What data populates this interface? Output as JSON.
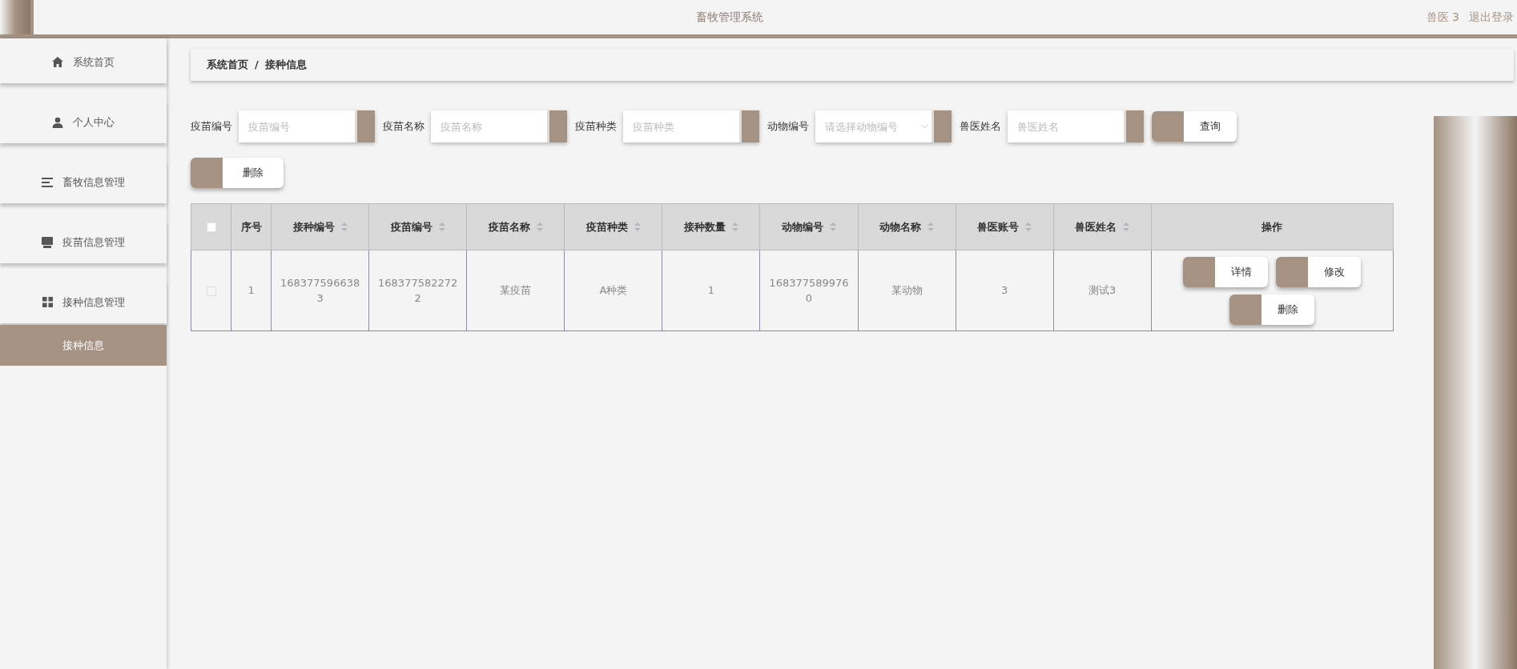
{
  "header": {
    "title": "畜牧管理系统",
    "user": "兽医 3",
    "logout": "退出登录"
  },
  "sidebar": {
    "items": [
      {
        "label": "系统首页",
        "selected": false
      },
      {
        "label": "个人中心",
        "selected": false
      },
      {
        "label": "畜牧信息管理",
        "selected": false
      },
      {
        "label": "疫苗信息管理",
        "selected": false
      },
      {
        "label": "接种信息管理",
        "selected": false,
        "children": [
          {
            "label": "接种信息",
            "selected": true
          }
        ]
      }
    ]
  },
  "breadcrumb": [
    "系统首页",
    "接种信息"
  ],
  "breadcrumb_separator": "/",
  "filters": [
    {
      "label": "疫苗编号",
      "placeholder": "疫苗编号",
      "kind": "text"
    },
    {
      "label": "疫苗名称",
      "placeholder": "疫苗名称",
      "kind": "text"
    },
    {
      "label": "疫苗种类",
      "placeholder": "疫苗种类",
      "kind": "text"
    },
    {
      "label": "动物编号",
      "placeholder": "请选择动物编号",
      "kind": "select"
    },
    {
      "label": "兽医姓名",
      "placeholder": "兽医姓名",
      "kind": "text"
    }
  ],
  "search_button": "查询",
  "delete_button": "删除",
  "table": {
    "columns": [
      {
        "label": "序号",
        "sortable": false
      },
      {
        "label": "接种编号",
        "sortable": true
      },
      {
        "label": "疫苗编号",
        "sortable": true
      },
      {
        "label": "疫苗名称",
        "sortable": true
      },
      {
        "label": "疫苗种类",
        "sortable": true
      },
      {
        "label": "接种数量",
        "sortable": true
      },
      {
        "label": "动物编号",
        "sortable": true
      },
      {
        "label": "动物名称",
        "sortable": true
      },
      {
        "label": "兽医账号",
        "sortable": true
      },
      {
        "label": "兽医姓名",
        "sortable": true
      },
      {
        "label": "操作",
        "sortable": false
      }
    ],
    "all_checked": false,
    "rows": [
      {
        "checked": false,
        "cells": [
          "1",
          "1683775966383",
          "1683775822722",
          "某疫苗",
          "A种类",
          "1",
          "1683775899760",
          "某动物",
          "3",
          "测试3"
        ],
        "actions": [
          "详情",
          "修改",
          "删除"
        ]
      }
    ]
  }
}
